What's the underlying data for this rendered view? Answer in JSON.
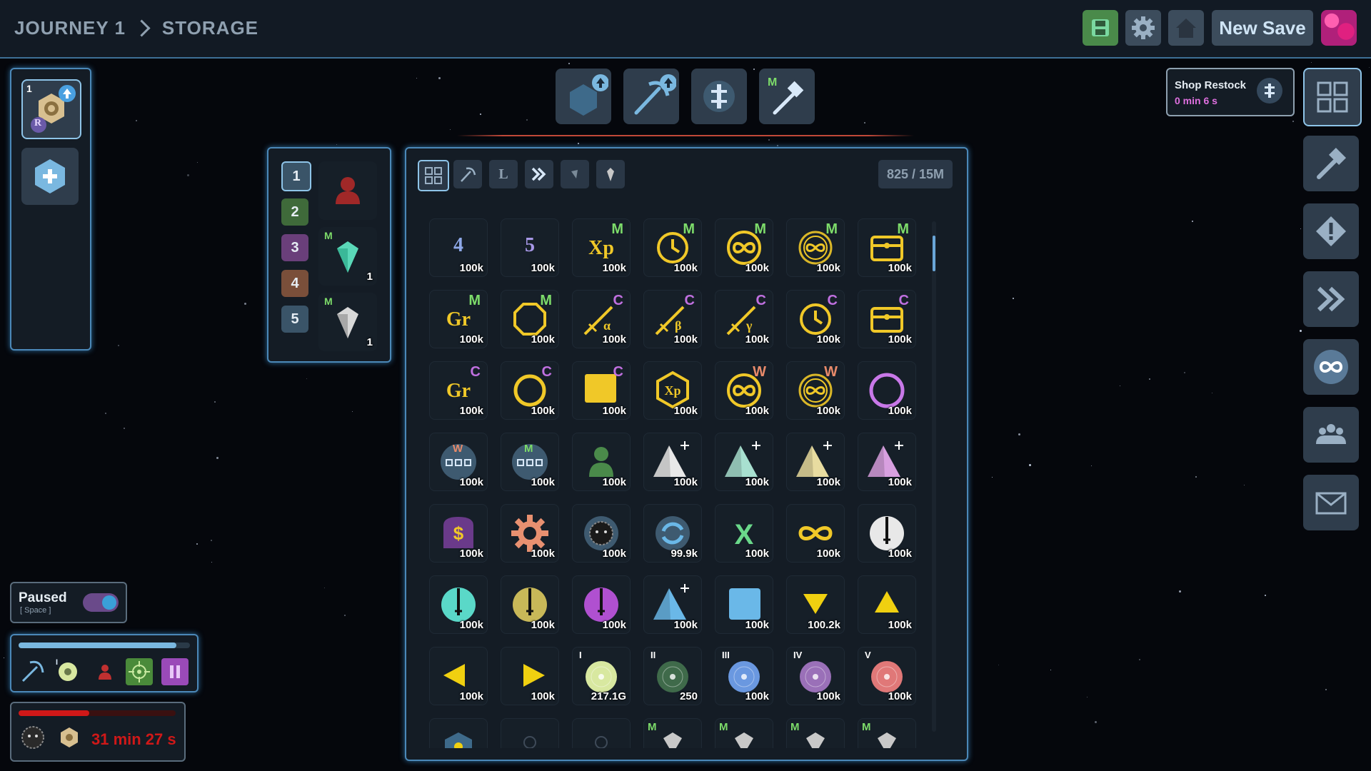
{
  "breadcrumb": {
    "journey": "JOURNEY 1",
    "page": "STORAGE"
  },
  "topbar": {
    "new_save_label": "New Save"
  },
  "shop": {
    "title": "Shop Restock",
    "timer": "0 min 6 s"
  },
  "storage": {
    "capacity": "825 / 15M"
  },
  "loadout": {
    "slots": [
      {
        "num": "1",
        "color": "#3a5468",
        "item_badge": "",
        "count": ""
      },
      {
        "num": "2",
        "color": "#3f6a3a",
        "item_badge": "M",
        "count": "1"
      },
      {
        "num": "3",
        "color": "#6a3f7a",
        "item_badge": "M",
        "count": "1"
      },
      {
        "num": "4",
        "color": "#7a4f3a",
        "item_badge": "",
        "count": ""
      },
      {
        "num": "5",
        "color": "#3a5468",
        "item_badge": "",
        "count": ""
      }
    ]
  },
  "left_panel": {
    "slot_number": "1",
    "badge": "R"
  },
  "paused": {
    "label": "Paused",
    "hint": "[ Space ]",
    "on": true
  },
  "activity": {
    "progress": 0.92,
    "level": "I"
  },
  "timer": {
    "text": "31 min 27 s",
    "progress": 0.45
  },
  "grid": [
    {
      "icon": "num",
      "glyph": "4",
      "color": "#8ea8e8",
      "count": "100k"
    },
    {
      "icon": "num",
      "glyph": "5",
      "color": "#a898e8",
      "count": "100k"
    },
    {
      "icon": "xp",
      "sup": "M",
      "supColor": "#7ddc6a",
      "count": "100k"
    },
    {
      "icon": "clock",
      "sup": "M",
      "supColor": "#7ddc6a",
      "count": "100k"
    },
    {
      "icon": "inf-ring",
      "sup": "M",
      "supColor": "#7ddc6a",
      "count": "100k"
    },
    {
      "icon": "inf-ring2",
      "sup": "M",
      "supColor": "#7ddc6a",
      "count": "100k"
    },
    {
      "icon": "chest",
      "sup": "M",
      "supColor": "#7ddc6a",
      "count": "100k"
    },
    {
      "icon": "gr",
      "sup": "M",
      "supColor": "#7ddc6a",
      "count": "100k"
    },
    {
      "icon": "octagon",
      "sup": "M",
      "supColor": "#7ddc6a",
      "count": "100k"
    },
    {
      "icon": "wand",
      "glyph": "α",
      "sup": "C",
      "supColor": "#c070e0",
      "count": "100k"
    },
    {
      "icon": "wand",
      "glyph": "β",
      "sup": "C",
      "supColor": "#c070e0",
      "count": "100k"
    },
    {
      "icon": "wand",
      "glyph": "γ",
      "sup": "C",
      "supColor": "#c070e0",
      "count": "100k"
    },
    {
      "icon": "clock",
      "sup": "C",
      "supColor": "#c070e0",
      "count": "100k"
    },
    {
      "icon": "chest",
      "sup": "C",
      "supColor": "#c070e0",
      "count": "100k"
    },
    {
      "icon": "gr",
      "sup": "C",
      "supColor": "#c070e0",
      "count": "100k"
    },
    {
      "icon": "ring",
      "sup": "C",
      "supColor": "#c070e0",
      "count": "100k"
    },
    {
      "icon": "square-y",
      "sup": "C",
      "supColor": "#c070e0",
      "count": "100k"
    },
    {
      "icon": "hex-xp",
      "count": "100k"
    },
    {
      "icon": "inf-ring",
      "sup": "W",
      "supColor": "#e88a6a",
      "count": "100k"
    },
    {
      "icon": "inf-ring2",
      "sup": "W",
      "supColor": "#e88a6a",
      "count": "100k"
    },
    {
      "icon": "ring-purple",
      "count": "100k"
    },
    {
      "icon": "dots",
      "sup": "W",
      "supColor": "#e88a6a",
      "count": "100k"
    },
    {
      "icon": "dots",
      "sup": "M",
      "supColor": "#7ddc6a",
      "count": "100k"
    },
    {
      "icon": "person-green",
      "count": "100k"
    },
    {
      "icon": "pyramid",
      "color": "#e8e8e8",
      "count": "100k"
    },
    {
      "icon": "pyramid",
      "color": "#a8e0d0",
      "count": "100k"
    },
    {
      "icon": "pyramid",
      "color": "#e8dca0",
      "count": "100k"
    },
    {
      "icon": "pyramid",
      "color": "#d8a0e0",
      "count": "100k"
    },
    {
      "icon": "bag",
      "count": "100k"
    },
    {
      "icon": "gear",
      "count": "100k"
    },
    {
      "icon": "blob",
      "count": "100k"
    },
    {
      "icon": "refresh",
      "count": "99.9k"
    },
    {
      "icon": "x-green",
      "count": "100k"
    },
    {
      "icon": "inf-yellow",
      "count": "100k"
    },
    {
      "icon": "sword",
      "color": "#e8e8e8",
      "count": "100k"
    },
    {
      "icon": "sword",
      "color": "#5ad8c8",
      "count": "100k"
    },
    {
      "icon": "sword",
      "color": "#c8b858",
      "count": "100k"
    },
    {
      "icon": "sword",
      "color": "#b050d0",
      "count": "100k"
    },
    {
      "icon": "pyramid",
      "color": "#6ab8e8",
      "count": "100k"
    },
    {
      "icon": "square-b",
      "count": "100k"
    },
    {
      "icon": "tri-down",
      "count": "100.2k"
    },
    {
      "icon": "tri-up",
      "count": "100k"
    },
    {
      "icon": "tri-left",
      "count": "100k"
    },
    {
      "icon": "tri-right",
      "count": "100k"
    },
    {
      "icon": "planet",
      "glyph": "I",
      "color": "#d8e8a0",
      "count": "217.1G"
    },
    {
      "icon": "planet",
      "glyph": "II",
      "color": "#3f6a4a",
      "count": "250"
    },
    {
      "icon": "planet",
      "glyph": "III",
      "color": "#6a98e0",
      "count": "100k"
    },
    {
      "icon": "planet",
      "glyph": "IV",
      "color": "#9a70b8",
      "count": "100k"
    },
    {
      "icon": "planet",
      "glyph": "V",
      "color": "#e07878",
      "count": "100k"
    },
    {
      "icon": "hex-partial",
      "count": ""
    },
    {
      "icon": "faint",
      "count": ""
    },
    {
      "icon": "faint",
      "count": ""
    },
    {
      "icon": "gem-partial",
      "sup": "M",
      "supColor": "#7ddc6a",
      "count": ""
    },
    {
      "icon": "gem-partial",
      "sup": "M",
      "supColor": "#7ddc6a",
      "count": ""
    },
    {
      "icon": "gem-partial",
      "sup": "M",
      "supColor": "#7ddc6a",
      "count": ""
    },
    {
      "icon": "gem-partial",
      "sup": "M",
      "supColor": "#7ddc6a",
      "count": ""
    }
  ]
}
